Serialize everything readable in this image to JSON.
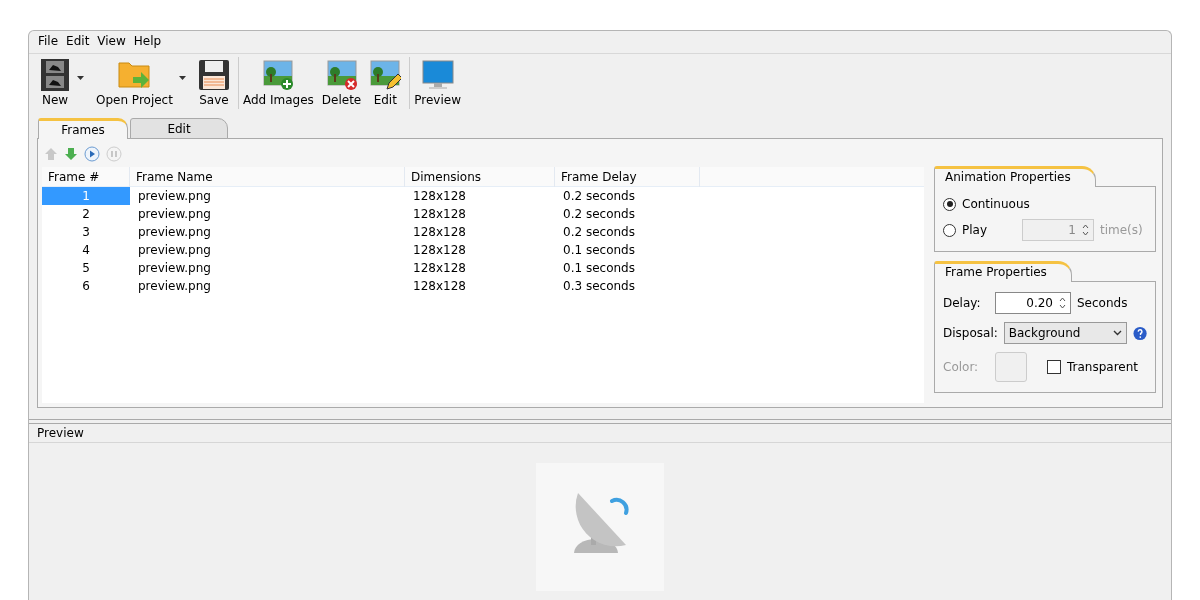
{
  "menu": [
    "File",
    "Edit",
    "View",
    "Help"
  ],
  "toolbar": [
    [
      {
        "label": "New",
        "kind": "film",
        "dropdown": true
      },
      {
        "label": "Open Project",
        "kind": "folder",
        "dropdown": true
      },
      {
        "label": "Save",
        "kind": "disk",
        "dropdown": false
      }
    ],
    [
      {
        "label": "Add Images",
        "kind": "add",
        "dropdown": false
      },
      {
        "label": "Delete",
        "kind": "delete",
        "dropdown": false
      },
      {
        "label": "Edit",
        "kind": "edit",
        "dropdown": false
      }
    ],
    [
      {
        "label": "Preview",
        "kind": "monitor",
        "dropdown": false
      }
    ]
  ],
  "tabs": [
    {
      "label": "Frames",
      "selected": true
    },
    {
      "label": "Edit",
      "selected": false
    }
  ],
  "frame_controls": [
    {
      "kind": "up",
      "disabled": true
    },
    {
      "kind": "down",
      "disabled": false
    },
    {
      "kind": "play",
      "disabled": false
    },
    {
      "kind": "pause",
      "disabled": true
    }
  ],
  "table": {
    "columns": [
      "Frame #",
      "Frame Name",
      "Dimensions",
      "Frame Delay"
    ],
    "rows": [
      {
        "cells": [
          "1",
          "preview.png",
          "128x128",
          "0.2 seconds"
        ],
        "selected": true
      },
      {
        "cells": [
          "2",
          "preview.png",
          "128x128",
          "0.2 seconds"
        ],
        "selected": false
      },
      {
        "cells": [
          "3",
          "preview.png",
          "128x128",
          "0.2 seconds"
        ],
        "selected": false
      },
      {
        "cells": [
          "4",
          "preview.png",
          "128x128",
          "0.1 seconds"
        ],
        "selected": false
      },
      {
        "cells": [
          "5",
          "preview.png",
          "128x128",
          "0.1 seconds"
        ],
        "selected": false
      },
      {
        "cells": [
          "6",
          "preview.png",
          "128x128",
          "0.3 seconds"
        ],
        "selected": false
      }
    ]
  },
  "animation_properties": {
    "title": "Animation Properties",
    "options": [
      {
        "label": "Continuous",
        "selected": true
      },
      {
        "label": "Play",
        "selected": false
      }
    ],
    "play_count": {
      "value": "1",
      "disabled": true
    },
    "unit": "time(s)"
  },
  "frame_properties": {
    "title": "Frame Properties",
    "delay": {
      "label": "Delay:",
      "value": "0.20",
      "unit": "Seconds"
    },
    "disposal": {
      "label": "Disposal:",
      "value": "Background"
    },
    "color": {
      "label": "Color:",
      "disabled": true
    },
    "transparent": {
      "label": "Transparent",
      "checked": false
    }
  },
  "preview": {
    "title": "Preview"
  }
}
